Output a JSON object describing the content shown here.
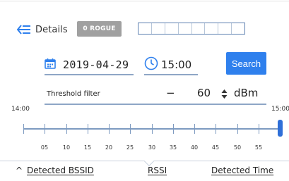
{
  "header": {
    "details_label": "Details",
    "rogue_badge": "0 ROGUE",
    "rogue_bar_segments": 8,
    "rogue_bar_filled": 0
  },
  "query": {
    "date": "2019-04-29",
    "time": "15:00",
    "search_label": "Search"
  },
  "threshold": {
    "label": "Threshold filter",
    "sign": "−",
    "value": "60",
    "unit": "dBm"
  },
  "timeline": {
    "start_label": "14:00",
    "end_label": "15:00",
    "minute_labels": [
      "05",
      "10",
      "15",
      "20",
      "25",
      "30",
      "35",
      "40",
      "45",
      "50",
      "55"
    ],
    "position": 1.0
  },
  "columns": {
    "sort_indicator": "^",
    "bssid": "Detected BSSID",
    "rssi": "RSSI",
    "time": "Detected Time"
  },
  "colors": {
    "accent": "#2f80ed",
    "field_underline": "#8ea6c6",
    "badge": "#a0a0a0",
    "handle": "#2f6fd8"
  }
}
